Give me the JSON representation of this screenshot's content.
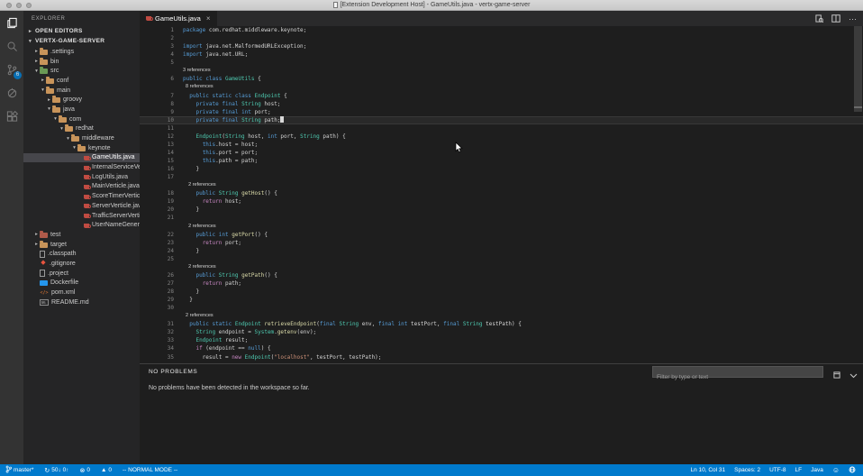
{
  "title_bar": {
    "title": "[Extension Development Host] - GameUtils.java - vertx-game-server"
  },
  "colors": {
    "accent": "#007acc",
    "editor_bg": "#1e1e1e",
    "sidebar_bg": "#252526",
    "activity_bg": "#333333",
    "keyword": "#569cd6",
    "type": "#4ec9b0",
    "function": "#dcdcaa",
    "control": "#c586c0",
    "string": "#ce9178",
    "text": "#d4d4d4",
    "codelens": "#8a8a8a",
    "line_number": "#858585"
  },
  "activity_bar": {
    "items": [
      {
        "icon": "files-icon",
        "active": true
      },
      {
        "icon": "search-icon",
        "active": false
      },
      {
        "icon": "source-control-icon",
        "active": false,
        "badge": "6"
      },
      {
        "icon": "debug-icon",
        "active": false
      },
      {
        "icon": "extensions-icon",
        "active": false
      }
    ]
  },
  "sidebar": {
    "title": "EXPLORER",
    "sections": [
      {
        "label": "OPEN EDITORS",
        "arrow": "▸"
      },
      {
        "label": "VERTX-GAME-SERVER",
        "arrow": "▾"
      }
    ],
    "tree": [
      {
        "label": ".settings",
        "indent": 1,
        "arrow": "▸",
        "icon": "folder"
      },
      {
        "label": "bin",
        "indent": 1,
        "arrow": "▸",
        "icon": "folder"
      },
      {
        "label": "src",
        "indent": 1,
        "arrow": "▾",
        "icon": "folder-src"
      },
      {
        "label": "conf",
        "indent": 2,
        "arrow": "▸",
        "icon": "folder"
      },
      {
        "label": "main",
        "indent": 2,
        "arrow": "▾",
        "icon": "folder"
      },
      {
        "label": "groovy",
        "indent": 3,
        "arrow": "▸",
        "icon": "folder"
      },
      {
        "label": "java",
        "indent": 3,
        "arrow": "▾",
        "icon": "folder"
      },
      {
        "label": "com",
        "indent": 4,
        "arrow": "▾",
        "icon": "folder"
      },
      {
        "label": "redhat",
        "indent": 5,
        "arrow": "▾",
        "icon": "folder"
      },
      {
        "label": "middleware",
        "indent": 6,
        "arrow": "▾",
        "icon": "folder"
      },
      {
        "label": "keynote",
        "indent": 7,
        "arrow": "▾",
        "icon": "folder"
      },
      {
        "label": "GameUtils.java",
        "indent": 8,
        "icon": "java",
        "selected": true
      },
      {
        "label": "InternalServiceVer...",
        "indent": 8,
        "icon": "java"
      },
      {
        "label": "LogUtils.java",
        "indent": 8,
        "icon": "java"
      },
      {
        "label": "MainVerticle.java",
        "indent": 8,
        "icon": "java"
      },
      {
        "label": "ScoreTimerVerticl...",
        "indent": 8,
        "icon": "java"
      },
      {
        "label": "ServerVerticle.java",
        "indent": 8,
        "icon": "java"
      },
      {
        "label": "TrafficServerVerti...",
        "indent": 8,
        "icon": "java"
      },
      {
        "label": "UserNameGenerat...",
        "indent": 8,
        "icon": "java"
      },
      {
        "label": "test",
        "indent": 1,
        "arrow": "▸",
        "icon": "folder-test"
      },
      {
        "label": "target",
        "indent": 1,
        "arrow": "▸",
        "icon": "folder"
      },
      {
        "label": ".classpath",
        "indent": 1,
        "icon": "file"
      },
      {
        "label": ".gitignore",
        "indent": 1,
        "icon": "git"
      },
      {
        "label": ".project",
        "indent": 1,
        "icon": "file"
      },
      {
        "label": "Dockerfile",
        "indent": 1,
        "icon": "docker"
      },
      {
        "label": "pom.xml",
        "indent": 1,
        "icon": "xml"
      },
      {
        "label": "README.md",
        "indent": 1,
        "icon": "md"
      }
    ]
  },
  "editor": {
    "tabs": [
      {
        "label": "GameUtils.java",
        "close": "×",
        "active": true
      }
    ],
    "rows": [
      {
        "n": "1",
        "seg": [
          [
            "k",
            "package"
          ],
          [
            "t",
            " com.redhat.middleware.keynote;"
          ]
        ]
      },
      {
        "n": "2",
        "seg": []
      },
      {
        "n": "3",
        "seg": [
          [
            "k",
            "import"
          ],
          [
            "t",
            " java.net.MalformedURLException;"
          ]
        ]
      },
      {
        "n": "4",
        "seg": [
          [
            "k",
            "import"
          ],
          [
            "t",
            " java.net.URL;"
          ]
        ]
      },
      {
        "n": "5",
        "seg": []
      },
      {
        "lens": true,
        "seg": [
          [
            "t",
            "3 references"
          ]
        ]
      },
      {
        "n": "6",
        "seg": [
          [
            "k",
            "public"
          ],
          [
            "t",
            " "
          ],
          [
            "k",
            "class"
          ],
          [
            "t",
            " "
          ],
          [
            "c",
            "GameUtils"
          ],
          [
            "t",
            " {"
          ]
        ]
      },
      {
        "lens": true,
        "seg": [
          [
            "t",
            "  8 references"
          ]
        ]
      },
      {
        "n": "7",
        "seg": [
          [
            "t",
            "  "
          ],
          [
            "k",
            "public"
          ],
          [
            "t",
            " "
          ],
          [
            "k",
            "static"
          ],
          [
            "t",
            " "
          ],
          [
            "k",
            "class"
          ],
          [
            "t",
            " "
          ],
          [
            "c",
            "Endpoint"
          ],
          [
            "t",
            " {"
          ]
        ]
      },
      {
        "n": "8",
        "seg": [
          [
            "t",
            "    "
          ],
          [
            "k",
            "private"
          ],
          [
            "t",
            " "
          ],
          [
            "k",
            "final"
          ],
          [
            "t",
            " "
          ],
          [
            "c",
            "String"
          ],
          [
            "t",
            " host;"
          ]
        ]
      },
      {
        "n": "9",
        "seg": [
          [
            "t",
            "    "
          ],
          [
            "k",
            "private"
          ],
          [
            "t",
            " "
          ],
          [
            "k",
            "final"
          ],
          [
            "t",
            " "
          ],
          [
            "k",
            "int"
          ],
          [
            "t",
            " port;"
          ]
        ]
      },
      {
        "n": "10",
        "cursor": true,
        "current": true,
        "seg": [
          [
            "t",
            "    "
          ],
          [
            "k",
            "private"
          ],
          [
            "t",
            " "
          ],
          [
            "k",
            "final"
          ],
          [
            "t",
            " "
          ],
          [
            "c",
            "String"
          ],
          [
            "t",
            " path;"
          ]
        ]
      },
      {
        "n": "11",
        "seg": []
      },
      {
        "n": "12",
        "seg": [
          [
            "t",
            "    "
          ],
          [
            "c",
            "Endpoint"
          ],
          [
            "t",
            "("
          ],
          [
            "c",
            "String"
          ],
          [
            "t",
            " host, "
          ],
          [
            "k",
            "int"
          ],
          [
            "t",
            " port, "
          ],
          [
            "c",
            "String"
          ],
          [
            "t",
            " path) {"
          ]
        ]
      },
      {
        "n": "13",
        "seg": [
          [
            "t",
            "      "
          ],
          [
            "k",
            "this"
          ],
          [
            "t",
            ".host = host;"
          ]
        ]
      },
      {
        "n": "14",
        "seg": [
          [
            "t",
            "      "
          ],
          [
            "k",
            "this"
          ],
          [
            "t",
            ".port = port;"
          ]
        ]
      },
      {
        "n": "15",
        "seg": [
          [
            "t",
            "      "
          ],
          [
            "k",
            "this"
          ],
          [
            "t",
            ".path = path;"
          ]
        ]
      },
      {
        "n": "16",
        "seg": [
          [
            "t",
            "    }"
          ]
        ]
      },
      {
        "n": "17",
        "seg": []
      },
      {
        "lens": true,
        "seg": [
          [
            "t",
            "    2 references"
          ]
        ]
      },
      {
        "n": "18",
        "seg": [
          [
            "t",
            "    "
          ],
          [
            "k",
            "public"
          ],
          [
            "t",
            " "
          ],
          [
            "c",
            "String"
          ],
          [
            "t",
            " "
          ],
          [
            "f",
            "getHost"
          ],
          [
            "t",
            "() {"
          ]
        ]
      },
      {
        "n": "19",
        "seg": [
          [
            "t",
            "      "
          ],
          [
            "p",
            "return"
          ],
          [
            "t",
            " host;"
          ]
        ]
      },
      {
        "n": "20",
        "seg": [
          [
            "t",
            "    }"
          ]
        ]
      },
      {
        "n": "21",
        "seg": []
      },
      {
        "lens": true,
        "seg": [
          [
            "t",
            "    2 references"
          ]
        ]
      },
      {
        "n": "22",
        "seg": [
          [
            "t",
            "    "
          ],
          [
            "k",
            "public"
          ],
          [
            "t",
            " "
          ],
          [
            "k",
            "int"
          ],
          [
            "t",
            " "
          ],
          [
            "f",
            "getPort"
          ],
          [
            "t",
            "() {"
          ]
        ]
      },
      {
        "n": "23",
        "seg": [
          [
            "t",
            "      "
          ],
          [
            "p",
            "return"
          ],
          [
            "t",
            " port;"
          ]
        ]
      },
      {
        "n": "24",
        "seg": [
          [
            "t",
            "    }"
          ]
        ]
      },
      {
        "n": "25",
        "seg": []
      },
      {
        "lens": true,
        "seg": [
          [
            "t",
            "    2 references"
          ]
        ]
      },
      {
        "n": "26",
        "seg": [
          [
            "t",
            "    "
          ],
          [
            "k",
            "public"
          ],
          [
            "t",
            " "
          ],
          [
            "c",
            "String"
          ],
          [
            "t",
            " "
          ],
          [
            "f",
            "getPath"
          ],
          [
            "t",
            "() {"
          ]
        ]
      },
      {
        "n": "27",
        "seg": [
          [
            "t",
            "      "
          ],
          [
            "p",
            "return"
          ],
          [
            "t",
            " path;"
          ]
        ]
      },
      {
        "n": "28",
        "seg": [
          [
            "t",
            "    }"
          ]
        ]
      },
      {
        "n": "29",
        "seg": [
          [
            "t",
            "  }"
          ]
        ]
      },
      {
        "n": "30",
        "seg": []
      },
      {
        "lens": true,
        "seg": [
          [
            "t",
            "  2 references"
          ]
        ]
      },
      {
        "n": "31",
        "seg": [
          [
            "t",
            "  "
          ],
          [
            "k",
            "public"
          ],
          [
            "t",
            " "
          ],
          [
            "k",
            "static"
          ],
          [
            "t",
            " "
          ],
          [
            "c",
            "Endpoint"
          ],
          [
            "t",
            " "
          ],
          [
            "f",
            "retrieveEndpoint"
          ],
          [
            "t",
            "("
          ],
          [
            "k",
            "final"
          ],
          [
            "t",
            " "
          ],
          [
            "c",
            "String"
          ],
          [
            "t",
            " env, "
          ],
          [
            "k",
            "final"
          ],
          [
            "t",
            " "
          ],
          [
            "k",
            "int"
          ],
          [
            "t",
            " testPort, "
          ],
          [
            "k",
            "final"
          ],
          [
            "t",
            " "
          ],
          [
            "c",
            "String"
          ],
          [
            "t",
            " testPath) {"
          ]
        ]
      },
      {
        "n": "32",
        "seg": [
          [
            "t",
            "    "
          ],
          [
            "c",
            "String"
          ],
          [
            "t",
            " endpoint = "
          ],
          [
            "c",
            "System"
          ],
          [
            "t",
            "."
          ],
          [
            "f",
            "getenv"
          ],
          [
            "t",
            "(env);"
          ]
        ]
      },
      {
        "n": "33",
        "seg": [
          [
            "t",
            "    "
          ],
          [
            "c",
            "Endpoint"
          ],
          [
            "t",
            " result;"
          ]
        ]
      },
      {
        "n": "34",
        "seg": [
          [
            "t",
            "    "
          ],
          [
            "p",
            "if"
          ],
          [
            "t",
            " (endpoint == "
          ],
          [
            "k",
            "null"
          ],
          [
            "t",
            ") {"
          ]
        ]
      },
      {
        "n": "35",
        "seg": [
          [
            "t",
            "      result = "
          ],
          [
            "p",
            "new"
          ],
          [
            "t",
            " "
          ],
          [
            "c",
            "Endpoint"
          ],
          [
            "t",
            "("
          ],
          [
            "s",
            "\"localhost\""
          ],
          [
            "t",
            ", testPort, testPath);"
          ]
        ]
      }
    ]
  },
  "panel": {
    "title": "NO PROBLEMS",
    "message": "No problems have been detected in the workspace so far.",
    "filter_placeholder": "Filter by type or text"
  },
  "status_bar": {
    "left": [
      {
        "name": "git-branch-status",
        "icon": "branch",
        "label": "master*"
      },
      {
        "name": "sync-status",
        "icon": "sync",
        "label": "50↓ 0↑"
      },
      {
        "name": "errors-status",
        "icon": "error",
        "label": "0"
      },
      {
        "name": "warnings-status",
        "icon": "warning",
        "label": "0"
      },
      {
        "name": "vim-mode-status",
        "label": "-- NORMAL MODE --"
      }
    ],
    "right": [
      {
        "name": "cursor-position-status",
        "label": "Ln 10, Col 31"
      },
      {
        "name": "indentation-status",
        "label": "Spaces: 2"
      },
      {
        "name": "encoding-status",
        "label": "UTF-8"
      },
      {
        "name": "eol-status",
        "label": "LF"
      },
      {
        "name": "language-mode-status",
        "label": "Java"
      },
      {
        "name": "feedback-status",
        "icon": "smiley",
        "label": ""
      },
      {
        "name": "telemetry-status",
        "icon": "globe",
        "label": ""
      }
    ]
  }
}
